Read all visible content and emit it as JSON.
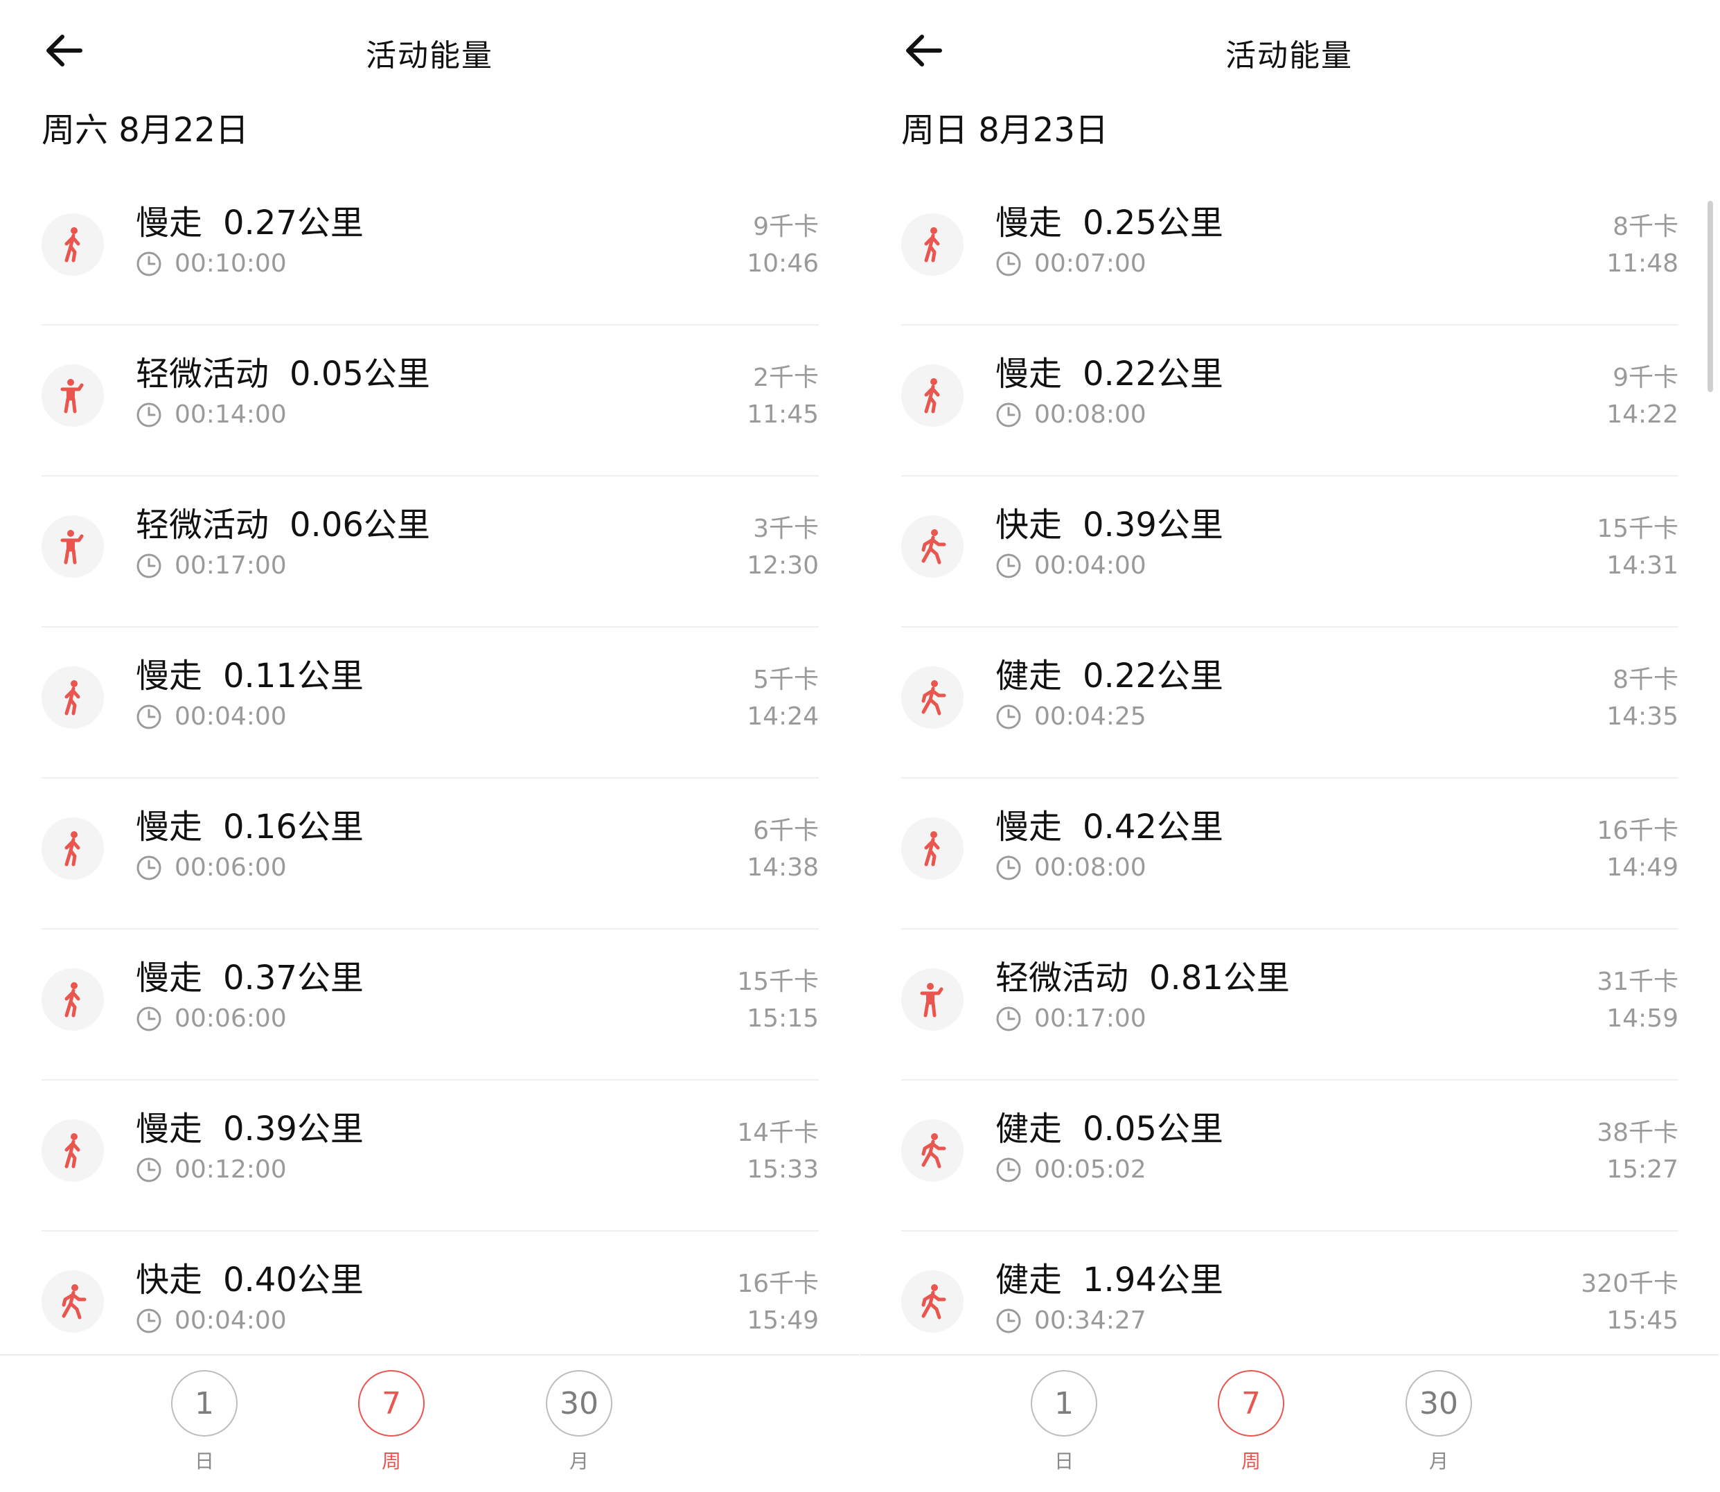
{
  "accent_color": "#e9554f",
  "panels": [
    {
      "title": "活动能量",
      "date": "周六 8月22日",
      "records": [
        {
          "type": "慢走",
          "icon": "slow-walk-icon",
          "distance": "0.27公里",
          "duration": "00:10:00",
          "kcal": "9千卡",
          "time": "10:46"
        },
        {
          "type": "轻微活动",
          "icon": "light-activity-icon",
          "distance": "0.05公里",
          "duration": "00:14:00",
          "kcal": "2千卡",
          "time": "11:45"
        },
        {
          "type": "轻微活动",
          "icon": "light-activity-icon",
          "distance": "0.06公里",
          "duration": "00:17:00",
          "kcal": "3千卡",
          "time": "12:30"
        },
        {
          "type": "慢走",
          "icon": "slow-walk-icon",
          "distance": "0.11公里",
          "duration": "00:04:00",
          "kcal": "5千卡",
          "time": "14:24"
        },
        {
          "type": "慢走",
          "icon": "slow-walk-icon",
          "distance": "0.16公里",
          "duration": "00:06:00",
          "kcal": "6千卡",
          "time": "14:38"
        },
        {
          "type": "慢走",
          "icon": "slow-walk-icon",
          "distance": "0.37公里",
          "duration": "00:06:00",
          "kcal": "15千卡",
          "time": "15:15"
        },
        {
          "type": "慢走",
          "icon": "slow-walk-icon",
          "distance": "0.39公里",
          "duration": "00:12:00",
          "kcal": "14千卡",
          "time": "15:33"
        },
        {
          "type": "快走",
          "icon": "fast-walk-icon",
          "distance": "0.40公里",
          "duration": "00:04:00",
          "kcal": "16千卡",
          "time": "15:49"
        }
      ],
      "tabs": [
        {
          "number": "1",
          "label": "日",
          "active": false
        },
        {
          "number": "7",
          "label": "周",
          "active": true
        },
        {
          "number": "30",
          "label": "月",
          "active": false
        }
      ]
    },
    {
      "title": "活动能量",
      "date": "周日 8月23日",
      "records": [
        {
          "type": "慢走",
          "icon": "slow-walk-icon",
          "distance": "0.25公里",
          "duration": "00:07:00",
          "kcal": "8千卡",
          "time": "11:48"
        },
        {
          "type": "慢走",
          "icon": "slow-walk-icon",
          "distance": "0.22公里",
          "duration": "00:08:00",
          "kcal": "9千卡",
          "time": "14:22"
        },
        {
          "type": "快走",
          "icon": "fast-walk-icon",
          "distance": "0.39公里",
          "duration": "00:04:00",
          "kcal": "15千卡",
          "time": "14:31"
        },
        {
          "type": "健走",
          "icon": "fast-walk-icon",
          "distance": "0.22公里",
          "duration": "00:04:25",
          "kcal": "8千卡",
          "time": "14:35"
        },
        {
          "type": "慢走",
          "icon": "slow-walk-icon",
          "distance": "0.42公里",
          "duration": "00:08:00",
          "kcal": "16千卡",
          "time": "14:49"
        },
        {
          "type": "轻微活动",
          "icon": "light-activity-icon",
          "distance": "0.81公里",
          "duration": "00:17:00",
          "kcal": "31千卡",
          "time": "14:59"
        },
        {
          "type": "健走",
          "icon": "fast-walk-icon",
          "distance": "0.05公里",
          "duration": "00:05:02",
          "kcal": "38千卡",
          "time": "15:27"
        },
        {
          "type": "健走",
          "icon": "fast-walk-icon",
          "distance": "1.94公里",
          "duration": "00:34:27",
          "kcal": "320千卡",
          "time": "15:45"
        }
      ],
      "tabs": [
        {
          "number": "1",
          "label": "日",
          "active": false
        },
        {
          "number": "7",
          "label": "周",
          "active": true
        },
        {
          "number": "30",
          "label": "月",
          "active": false
        }
      ]
    }
  ]
}
